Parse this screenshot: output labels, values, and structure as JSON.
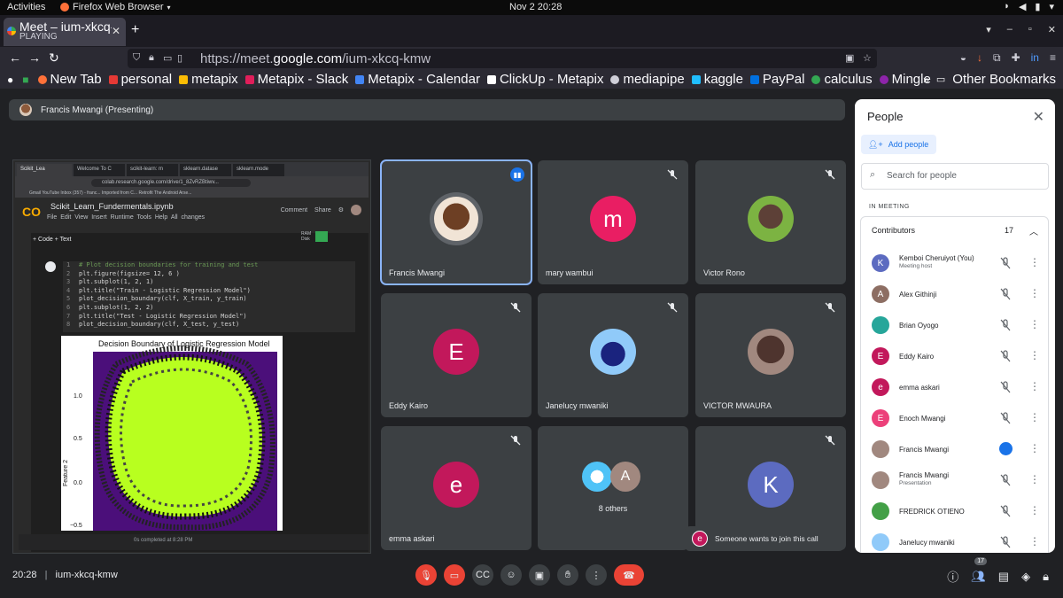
{
  "topbar": {
    "activities": "Activities",
    "app_menu": "Firefox Web Browser",
    "clock": "Nov 2  20:28"
  },
  "browser": {
    "tab_title": "Meet – ium-xkcq-",
    "tab_status": "PLAYING",
    "url_prefix": "https://meet.",
    "url_domain": "google.com",
    "url_path": "/ium-xkcq-kmw",
    "bookmarks": [
      {
        "label": "New Tab",
        "color": "#ff7139"
      },
      {
        "label": "personal",
        "color": "#e53935"
      },
      {
        "label": "metapix",
        "color": "#fbbc04"
      },
      {
        "label": "Metapix - Slack",
        "color": "#4a154b"
      },
      {
        "label": "Metapix - Calendar",
        "color": "#4285f4"
      },
      {
        "label": "ClickUp - Metapix",
        "color": "#7b68ee"
      },
      {
        "label": "mediapipe",
        "color": "#cfcfd8"
      },
      {
        "label": "kaggle",
        "color": "#20beff"
      },
      {
        "label": "PayPal",
        "color": "#003087"
      },
      {
        "label": "calculus",
        "color": "#34a853"
      },
      {
        "label": "Mingle",
        "color": "#8e24aa"
      }
    ],
    "other_bookmarks": "Other Bookmarks"
  },
  "meet": {
    "presenting_label": "Francis Mwangi (Presenting)",
    "shared_screen": {
      "tabs": [
        "Scikit_Lea",
        "Welcome To C",
        "scikit-learn: m",
        "sklearn.datase",
        "sklearn.mode"
      ],
      "url": "colab.research.google.com/drive/1_8ZvRZBtiwv...",
      "bookmarks_line": "Gmail   YouTube   Inbox (357) - franc...   Imported from C...   Retrofit   The Android Arse...",
      "notebook_title": "Scikit_Learn_Fundermentals.ipynb",
      "menu": "File  Edit  View  Insert  Runtime  Tools  Help",
      "all_changes": "All changes",
      "comment": "Comment",
      "share": "Share",
      "toolbar": "+ Code   + Text",
      "ram": "RAM Disk",
      "code_lines": [
        {
          "n": "1",
          "text": "# Plot decision boundaries for training and test",
          "comment": true
        },
        {
          "n": "2",
          "text": "plt.figure(figsize= 12, 6 )"
        },
        {
          "n": "3",
          "text": "plt.subplot(1, 2, 1)"
        },
        {
          "n": "4",
          "text": "plt.title(\"Train - Logistic Regression Model\")"
        },
        {
          "n": "5",
          "text": "plot_decision_boundary(clf, X_train, y_train)"
        },
        {
          "n": "6",
          "text": "plt.subplot(1, 2, 2)"
        },
        {
          "n": "7",
          "text": "plt.title(\"Test - Logistic Regression Model\")"
        },
        {
          "n": "8",
          "text": "plot_decision_boundary(clf, X_test, y_test)"
        }
      ],
      "plot_title": "Decision Boundary of Logistic Regression Model",
      "plot_ylabel": "Feature 2",
      "plot_yticks": [
        "1.0",
        "0.5",
        "0.0",
        "−0.5"
      ],
      "status": "0s    completed at 8:28 PM"
    },
    "tiles": [
      {
        "name": "Francis Mwangi",
        "initial": "",
        "color": "#3c4043",
        "active": true
      },
      {
        "name": "mary wambui",
        "initial": "m",
        "color": "#e91e63"
      },
      {
        "name": "Victor Rono",
        "initial": "",
        "color": "#8bc34a"
      },
      {
        "name": "Eddy Kairo",
        "initial": "E",
        "color": "#c2185b"
      },
      {
        "name": "Janelucy mwaniki",
        "initial": "",
        "color": "#90caf9"
      },
      {
        "name": "VICTOR MWAURA",
        "initial": "",
        "color": "#6d4c41"
      },
      {
        "name": "emma askari",
        "initial": "e",
        "color": "#c2185b"
      },
      {
        "name": "",
        "initial": "",
        "color": "#3c4043"
      },
      {
        "name": "",
        "initial": "K",
        "color": "#5c6bc0"
      }
    ],
    "others_label": "8 others",
    "others_initial": "A",
    "toast": {
      "initial": "e",
      "text": "Someone wants to join this call"
    },
    "people_panel": {
      "title": "People",
      "add_people": "Add people",
      "search_placeholder": "Search for people",
      "in_meeting": "IN MEETING",
      "group_label": "Contributors",
      "group_count": "17",
      "people": [
        {
          "name": "Kemboi Cheruiyot (You)",
          "sub": "Meeting host",
          "initial": "K",
          "color": "#5c6bc0"
        },
        {
          "name": "Alex Githinji",
          "sub": "",
          "initial": "A",
          "color": "#8d6e63"
        },
        {
          "name": "Brian Oyogo",
          "sub": "",
          "initial": "",
          "color": "#26a69a"
        },
        {
          "name": "Eddy Kairo",
          "sub": "",
          "initial": "E",
          "color": "#c2185b"
        },
        {
          "name": "emma askari",
          "sub": "",
          "initial": "e",
          "color": "#c2185b"
        },
        {
          "name": "Enoch Mwangi",
          "sub": "",
          "initial": "E",
          "color": "#ec407a"
        },
        {
          "name": "Francis Mwangi",
          "sub": "",
          "initial": "",
          "color": "#a1887f",
          "speaking": true
        },
        {
          "name": "Francis Mwangi",
          "sub": "Presentation",
          "initial": "",
          "color": "#a1887f",
          "presentation": true
        },
        {
          "name": "FREDRICK OTIENO",
          "sub": "",
          "initial": "",
          "color": "#43a047"
        },
        {
          "name": "Janelucy mwaniki",
          "sub": "",
          "initial": "",
          "color": "#90caf9"
        }
      ]
    },
    "bottom": {
      "time": "20:28",
      "separator": "|",
      "code": "ium-xkcq-kmw",
      "people_badge": "17"
    }
  }
}
